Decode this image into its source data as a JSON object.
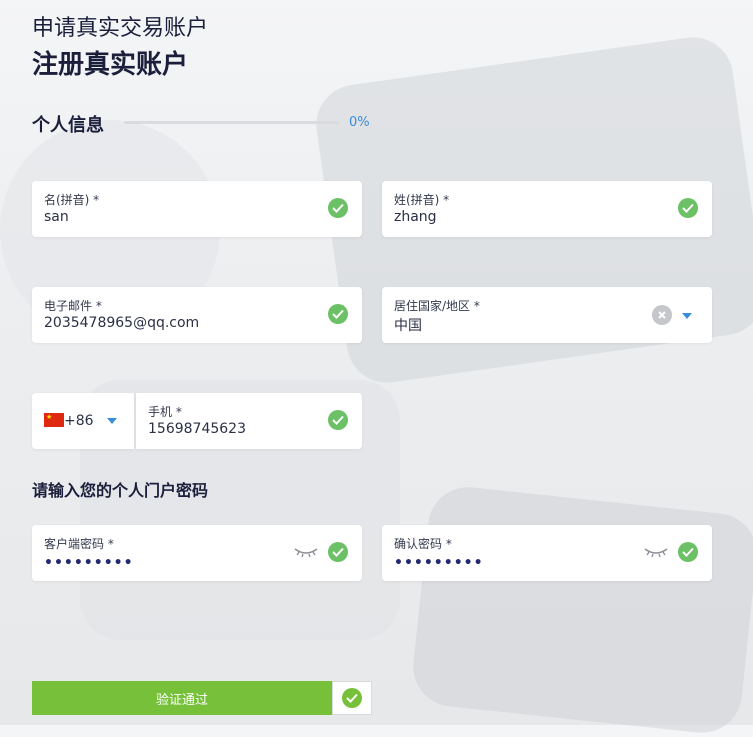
{
  "header": {
    "subtitle": "申请真实交易账户",
    "title": "注册真实账户"
  },
  "personal_section": {
    "title": "个人信息",
    "progress_percent": 0,
    "progress_label": "0%"
  },
  "fields": {
    "first_name": {
      "label": "名(拼音) *",
      "value": "san",
      "valid": true
    },
    "last_name": {
      "label": "姓(拼音) *",
      "value": "zhang",
      "valid": true
    },
    "email": {
      "label": "电子邮件 *",
      "value": "2035478965@qq.com",
      "valid": true
    },
    "country": {
      "label": "居住国家/地区 *",
      "value": "中国"
    },
    "phone_code": {
      "value": "+86",
      "flag": "china-flag-icon"
    },
    "phone": {
      "label": "手机 *",
      "value": "15698745623",
      "valid": true
    }
  },
  "password_section": {
    "title": "请输入您的个人门户密码",
    "client_password": {
      "label": "客户端密码 *",
      "masked": "•••••••••",
      "valid": true
    },
    "confirm_password": {
      "label": "确认密码 *",
      "masked": "•••••••••",
      "valid": true
    }
  },
  "submit": {
    "label": "验证通过"
  },
  "colors": {
    "accent_blue": "#3a8ddb",
    "valid_green": "#6cc066",
    "submit_green": "#76c03a",
    "text_dark": "#1b1f3b"
  }
}
